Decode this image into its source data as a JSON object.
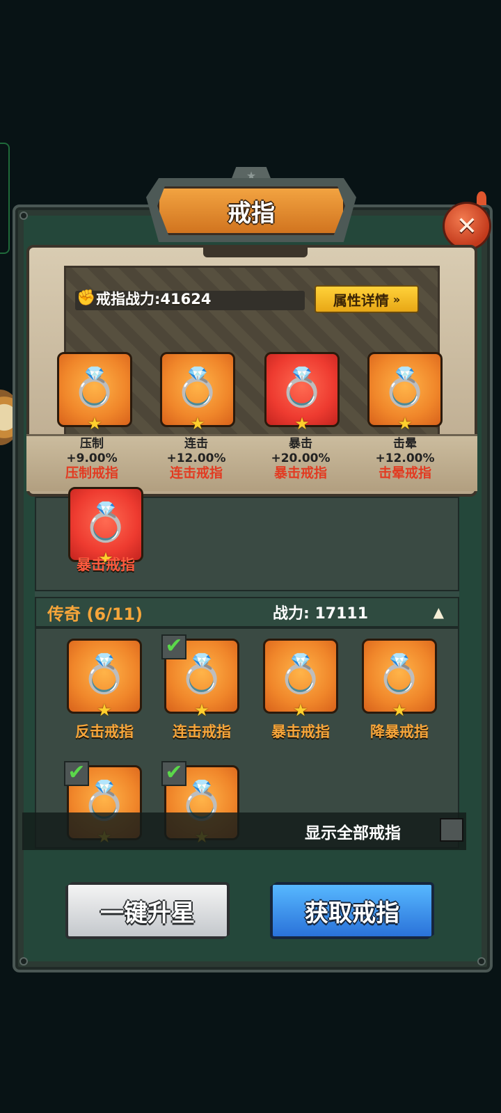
{
  "window": {
    "title": "戒指",
    "close_icon": "close-icon"
  },
  "power": {
    "label": "戒指战力:",
    "value": "41624",
    "icon": "fist-icon"
  },
  "attr_button": {
    "label": "属性详情",
    "icon": "double-chevron-right-icon"
  },
  "equipped": [
    {
      "stat": "压制",
      "value": "+9.00%",
      "name": "压制戒指",
      "color": "orange",
      "icon": "ring-purple-stone-icon"
    },
    {
      "stat": "连击",
      "value": "+12.00%",
      "name": "连击戒指",
      "color": "orange",
      "icon": "ring-steel-lightning-icon"
    },
    {
      "stat": "暴击",
      "value": "+20.00%",
      "name": "暴击戒指",
      "color": "red",
      "icon": "ring-ruby-crown-icon"
    },
    {
      "stat": "击晕",
      "value": "+12.00%",
      "name": "击晕戒指",
      "color": "orange",
      "icon": "ring-gold-bolt-icon"
    }
  ],
  "partial_item": {
    "name": "暴击戒指",
    "icon": "ring-ruby-crown-icon"
  },
  "section": {
    "title": "传奇 (6/11)",
    "power_label": "战力:",
    "power_value": "17111",
    "caret_icon": "caret-up-icon"
  },
  "cards": [
    {
      "name": "反击戒指",
      "checked": false,
      "icon": "ring-thorn-ruby-icon"
    },
    {
      "name": "连击戒指",
      "checked": true,
      "icon": "ring-steel-lightning-icon"
    },
    {
      "name": "暴击戒指",
      "checked": false,
      "icon": "ring-ruby-crown-icon"
    },
    {
      "name": "降暴戒指",
      "checked": false,
      "icon": "ring-silver-crest-icon"
    },
    {
      "name": "",
      "checked": true,
      "icon": "ring-purple-stone-icon"
    },
    {
      "name": "",
      "checked": true,
      "icon": "ring-gold-bolt-icon"
    }
  ],
  "show_all": {
    "label": "显示全部戒指",
    "checked": false
  },
  "buttons": {
    "star_up": "一键升星",
    "obtain": "获取戒指"
  }
}
